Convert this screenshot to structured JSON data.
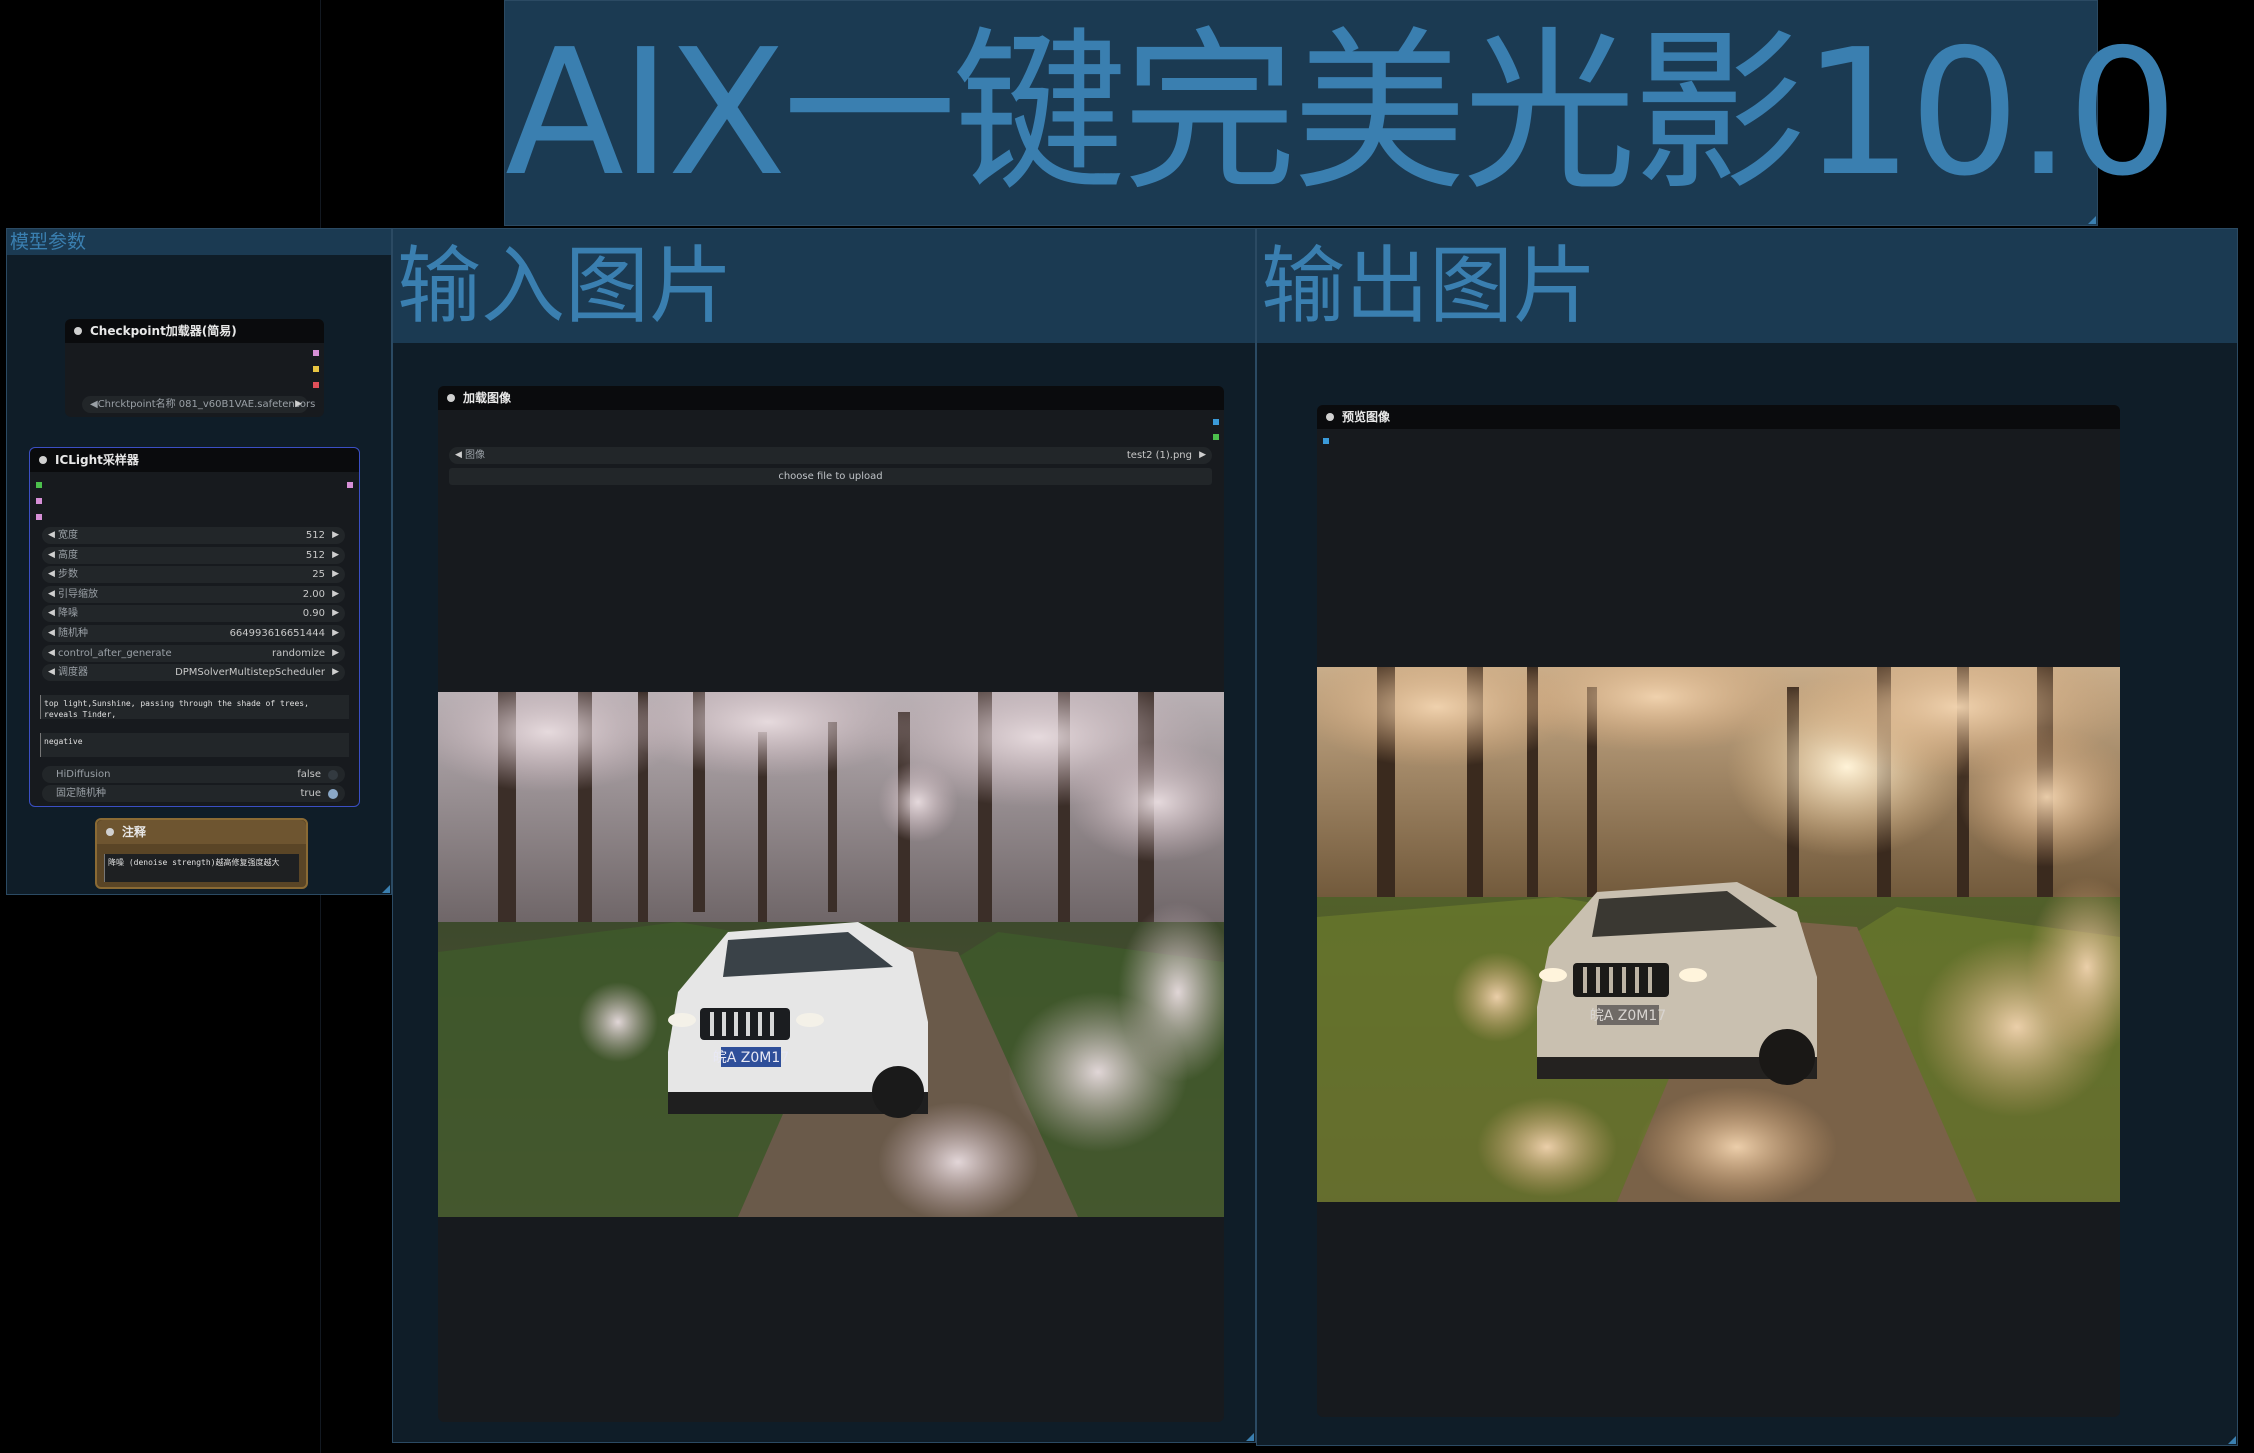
{
  "banner": {
    "title": "AIX一键完美光影10.0"
  },
  "groups": {
    "model_params": {
      "title": "模型参数"
    },
    "input": {
      "title": "输入图片"
    },
    "output": {
      "title": "输出图片"
    }
  },
  "checkpoint_node": {
    "title": "Checkpoint加载器(简易)",
    "ckpt_value": "◀Chrcktpoint名称 081_v60B1VAE.safetensors"
  },
  "iclight_node": {
    "title": "ICLight采样器",
    "widgets": [
      {
        "label": "宽度",
        "value": "512"
      },
      {
        "label": "高度",
        "value": "512"
      },
      {
        "label": "步数",
        "value": "25"
      },
      {
        "label": "引导缩放",
        "value": "2.00"
      },
      {
        "label": "降噪",
        "value": "0.90"
      },
      {
        "label": "随机种",
        "value": "664993616651444"
      },
      {
        "label": "control_after_generate",
        "value": "randomize"
      },
      {
        "label": "调度器",
        "value": "DPMSolverMultistepScheduler"
      }
    ],
    "positive_prompt": "top light,Sunshine, passing through the shade of trees, reveals Tinder,",
    "negative_prompt": "negative",
    "hidiffusion": {
      "label": "HiDiffusion",
      "value": "false"
    },
    "fixed_seed": {
      "label": "固定随机种",
      "value": "true"
    }
  },
  "note_node": {
    "title": "注释",
    "text": "降噪 (denoise strength)越高修复强度越大"
  },
  "load_image_node": {
    "title": "加载图像",
    "image_label": "图像",
    "image_value": "test2 (1).png",
    "upload_label": "choose file to upload",
    "plate_text": "皖A Z0M17"
  },
  "preview_node": {
    "title": "预览图像",
    "plate_text": "皖A Z0M17"
  },
  "colors": {
    "group_header": "#1b3a52",
    "group_title": "#3a7fb0",
    "port_pink": "#d68fd6",
    "port_yellow": "#e8c542",
    "port_red": "#e0505a",
    "port_green": "#4cbf4c",
    "port_blue": "#3a9ad9",
    "note_brown": "#5a4526"
  }
}
